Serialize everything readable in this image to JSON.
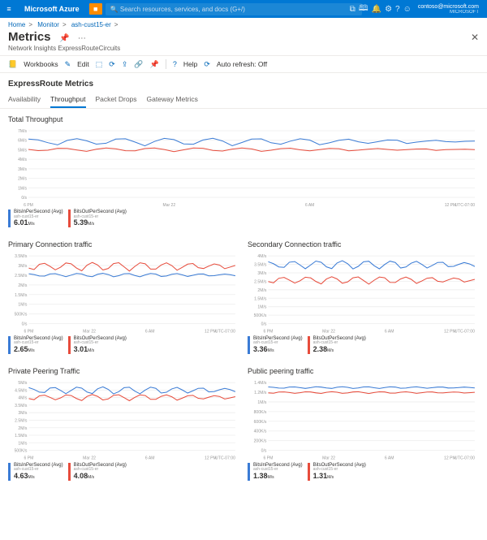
{
  "topbar": {
    "brand": "Microsoft Azure",
    "search_placeholder": "Search resources, services, and docs (G+/)",
    "account_email": "contoso@microsoft.com",
    "account_org": "MICROSOFT"
  },
  "breadcrumb": [
    {
      "label": "Home"
    },
    {
      "label": "Monitor"
    },
    {
      "label": "ash-cust15-er"
    }
  ],
  "page": {
    "title": "Metrics",
    "subtitle": "Network Insights ExpressRouteCircuits"
  },
  "toolbar": {
    "workbooks": "Workbooks",
    "edit": "Edit",
    "help": "Help",
    "autorefresh": "Auto refresh: Off"
  },
  "section_head": "ExpressRoute Metrics",
  "tabs": [
    {
      "label": "Availability",
      "active": false
    },
    {
      "label": "Throughput",
      "active": true
    },
    {
      "label": "Packet Drops",
      "active": false
    },
    {
      "label": "Gateway Metrics",
      "active": false
    }
  ],
  "axis_time": [
    "6 PM",
    "Mar 22",
    "6 AM",
    "12 PM"
  ],
  "tz": "UTC-07:00",
  "colors": {
    "blue": "#3a7bd5",
    "red": "#e74c3c"
  },
  "charts": {
    "total": {
      "title": "Total Throughput",
      "y": [
        "7M/s",
        "6M/s",
        "5M/s",
        "4M/s",
        "3M/s",
        "2M/s",
        "1M/s",
        "0/s"
      ],
      "legends": [
        {
          "name": "BitsInPerSecond (Avg)",
          "sub": "ash-cust15-er",
          "value": "6.01",
          "unit": "M/s",
          "color": "#3a7bd5"
        },
        {
          "name": "BitsOutPerSecond (Avg)",
          "sub": "ash-cust15-er",
          "value": "5.39",
          "unit": "M/s",
          "color": "#e74c3c"
        }
      ]
    },
    "primary": {
      "title": "Primary Connection traffic",
      "y": [
        "3.5M/s",
        "3M/s",
        "2.5M/s",
        "2M/s",
        "1.5M/s",
        "1M/s",
        "500K/s",
        "0/s"
      ],
      "legends": [
        {
          "name": "BitsInPerSecond (Avg)",
          "sub": "ash-cust15-er",
          "value": "2.65",
          "unit": "M/s",
          "color": "#3a7bd5"
        },
        {
          "name": "BitsOutPerSecond (Avg)",
          "sub": "ash-cust15-er",
          "value": "3.01",
          "unit": "M/s",
          "color": "#e74c3c"
        }
      ]
    },
    "secondary": {
      "title": "Secondary Connection traffic",
      "y": [
        "4M/s",
        "3.5M/s",
        "3M/s",
        "2.5M/s",
        "2M/s",
        "1.5M/s",
        "1M/s",
        "500K/s",
        "0/s"
      ],
      "legends": [
        {
          "name": "BitsInPerSecond (Avg)",
          "sub": "ash-cust15-er",
          "value": "3.36",
          "unit": "M/s",
          "color": "#3a7bd5"
        },
        {
          "name": "BitsOutPerSecond (Avg)",
          "sub": "ash-cust15-er",
          "value": "2.38",
          "unit": "M/s",
          "color": "#e74c3c"
        }
      ]
    },
    "private": {
      "title": "Private Peering Traffic",
      "y": [
        "5M/s",
        "4.5M/s",
        "4M/s",
        "3.5M/s",
        "3M/s",
        "2.5M/s",
        "2M/s",
        "1.5M/s",
        "1M/s",
        "500K/s"
      ],
      "legends": [
        {
          "name": "BitsInPerSecond (Avg)",
          "sub": "ash-cust15-er",
          "value": "4.63",
          "unit": "M/s",
          "color": "#3a7bd5"
        },
        {
          "name": "BitsOutPerSecond (Avg)",
          "sub": "ash-cust15-er",
          "value": "4.08",
          "unit": "M/s",
          "color": "#e74c3c"
        }
      ]
    },
    "public": {
      "title": "Public peering traffic",
      "y": [
        "1.4M/s",
        "1.2M/s",
        "1M/s",
        "800K/s",
        "600K/s",
        "400K/s",
        "200K/s",
        "0/s"
      ],
      "legends": [
        {
          "name": "BitsInPerSecond (Avg)",
          "sub": "ash-cust15-er",
          "value": "1.38",
          "unit": "M/s",
          "color": "#3a7bd5"
        },
        {
          "name": "BitsOutPerSecond (Avg)",
          "sub": "ash-cust15-er",
          "value": "1.31",
          "unit": "M/s",
          "color": "#e74c3c"
        }
      ]
    }
  },
  "chart_data": [
    {
      "id": "total",
      "type": "line",
      "title": "Total Throughput",
      "xlabel": "time",
      "ylabel": "bits/s",
      "ylim": [
        0,
        7000000
      ],
      "categories_hint": "~47 samples, 6 PM → ~2 PM next day",
      "series": [
        {
          "name": "BitsInPerSecond (Avg)",
          "avg": 6010000,
          "min_approx": 5800000,
          "max_approx": 6600000
        },
        {
          "name": "BitsOutPerSecond (Avg)",
          "avg": 5390000,
          "min_approx": 5200000,
          "max_approx": 5700000
        }
      ]
    },
    {
      "id": "primary",
      "type": "line",
      "title": "Primary Connection traffic",
      "ylim": [
        0,
        3500000
      ],
      "series": [
        {
          "name": "BitsInPerSecond (Avg)",
          "avg": 2650000,
          "min_approx": 2500000,
          "max_approx": 2900000
        },
        {
          "name": "BitsOutPerSecond (Avg)",
          "avg": 3010000,
          "min_approx": 2800000,
          "max_approx": 3500000
        }
      ]
    },
    {
      "id": "secondary",
      "type": "line",
      "title": "Secondary Connection traffic",
      "ylim": [
        0,
        4000000
      ],
      "series": [
        {
          "name": "BitsInPerSecond (Avg)",
          "avg": 3360000,
          "min_approx": 3100000,
          "max_approx": 3800000
        },
        {
          "name": "BitsOutPerSecond (Avg)",
          "avg": 2380000,
          "min_approx": 2100000,
          "max_approx": 2800000
        }
      ]
    },
    {
      "id": "private",
      "type": "line",
      "title": "Private Peering Traffic",
      "ylim": [
        500000,
        5000000
      ],
      "series": [
        {
          "name": "BitsInPerSecond (Avg)",
          "avg": 4630000,
          "min_approx": 4300000,
          "max_approx": 5000000
        },
        {
          "name": "BitsOutPerSecond (Avg)",
          "avg": 4080000,
          "min_approx": 3800000,
          "max_approx": 4400000
        }
      ]
    },
    {
      "id": "public",
      "type": "line",
      "title": "Public peering traffic",
      "ylim": [
        0,
        1400000
      ],
      "series": [
        {
          "name": "BitsInPerSecond (Avg)",
          "avg": 1380000,
          "min_approx": 1300000,
          "max_approx": 1420000
        },
        {
          "name": "BitsOutPerSecond (Avg)",
          "avg": 1310000,
          "min_approx": 1260000,
          "max_approx": 1350000
        }
      ]
    }
  ]
}
